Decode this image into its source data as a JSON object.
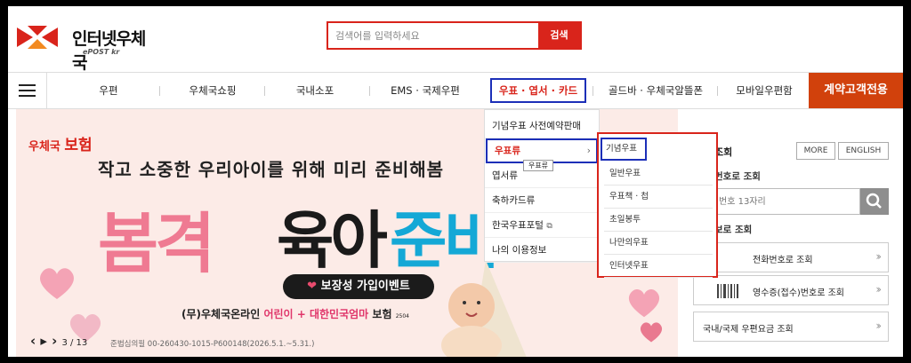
{
  "header": {
    "logo_text": "인터넷우체국",
    "logo_sub": "ePOST kr",
    "search_placeholder": "검색어를 입력하세요",
    "search_button": "검색"
  },
  "nav": {
    "items": [
      "우편",
      "우체국쇼핑",
      "국내소포",
      "EMS · 국제우편",
      "우표 · 엽서 · 카드",
      "골드바 · 우체국알뜰폰",
      "모바일우편함"
    ],
    "contract_button": "계약고객전용"
  },
  "banner": {
    "insurance_logo_a": "우체국",
    "insurance_logo_b": "보험",
    "headline": "작고 소중한 우리아이를 위해 미리 준비해봄",
    "big_a": "봄격",
    "big_b": "육아",
    "big_c": "준비",
    "event_pill": "보장성 가입이벤트",
    "promo_a": "(무)우체국온라인",
    "promo_b": "어린이 + 대한민국엄마",
    "promo_c": "보험",
    "promo_year": "2504",
    "disclaimer": "준법심의필 00-260430-1015-P600148(2026.5.1.~5.31.)",
    "slide_counter": "3 / 13"
  },
  "dropdown_level1": {
    "items": [
      "기념우표 사전예약판매",
      "우표류",
      "엽서류",
      "축하카드류",
      "한국우표포털",
      "나의 이용정보"
    ],
    "active_index": 1,
    "tooltip": "우표류"
  },
  "dropdown_level2": {
    "items": [
      "기념우표",
      "일반우표",
      "우표책 · 첩",
      "초일봉투",
      "나만의우표",
      "인터넷우표"
    ],
    "active_index": 0
  },
  "right_panel": {
    "title": "조회",
    "more": "MORE",
    "english": "ENGLISH",
    "sub1": "번호로 조회",
    "track_placeholder": "번호 13자리",
    "sub2": "보로 조회",
    "rows": [
      "전화번호로 조회",
      "영수증(접수)번호로 조회",
      "국내/국제 우편요금 조회"
    ]
  },
  "colors": {
    "brand_red": "#d9241b",
    "contract_orange": "#d1410c",
    "highlight_blue": "#1c2fb8",
    "banner_bg": "#fcebe7"
  }
}
